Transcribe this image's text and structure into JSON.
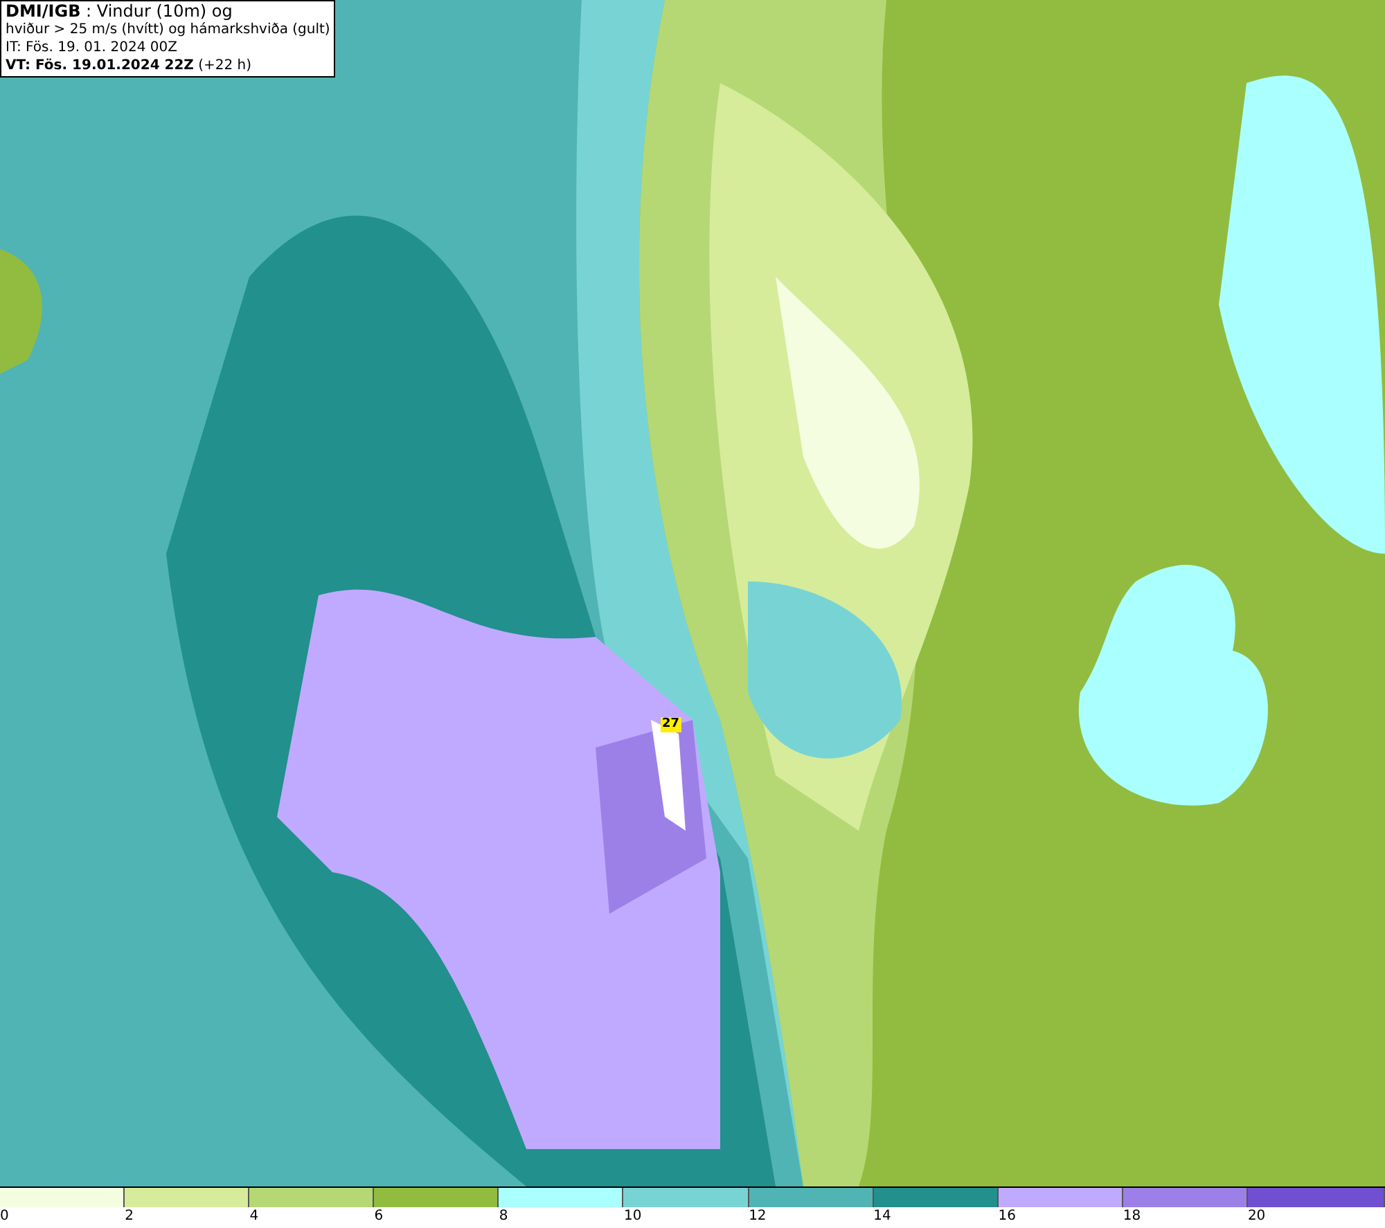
{
  "header": {
    "lines": [
      "**DMI/IGB** : Vindur (10m) og",
      "hviður > 25 m/s (hvítt) og hámarkshviða (gult)",
      "IT: Fös. 19. 01. 2024 00Z",
      "**VT: Fös. 19.01.2024 22Z** (+22 h)"
    ]
  },
  "map": {
    "gust_marker": "27"
  },
  "legend": [
    {
      "label": "0",
      "color": "#f4fde0"
    },
    {
      "label": "2",
      "color": "#d6ec9a"
    },
    {
      "label": "4",
      "color": "#b5d874"
    },
    {
      "label": "6",
      "color": "#92bc40"
    },
    {
      "label": "8",
      "color": "#aaffff"
    },
    {
      "label": "10",
      "color": "#78d4d4"
    },
    {
      "label": "12",
      "color": "#50b4b4"
    },
    {
      "label": "14",
      "color": "#22908c"
    },
    {
      "label": "16",
      "color": "#c0aaff"
    },
    {
      "label": "18",
      "color": "#9c80e8"
    },
    {
      "label": "20",
      "color": "#7050d0"
    }
  ]
}
